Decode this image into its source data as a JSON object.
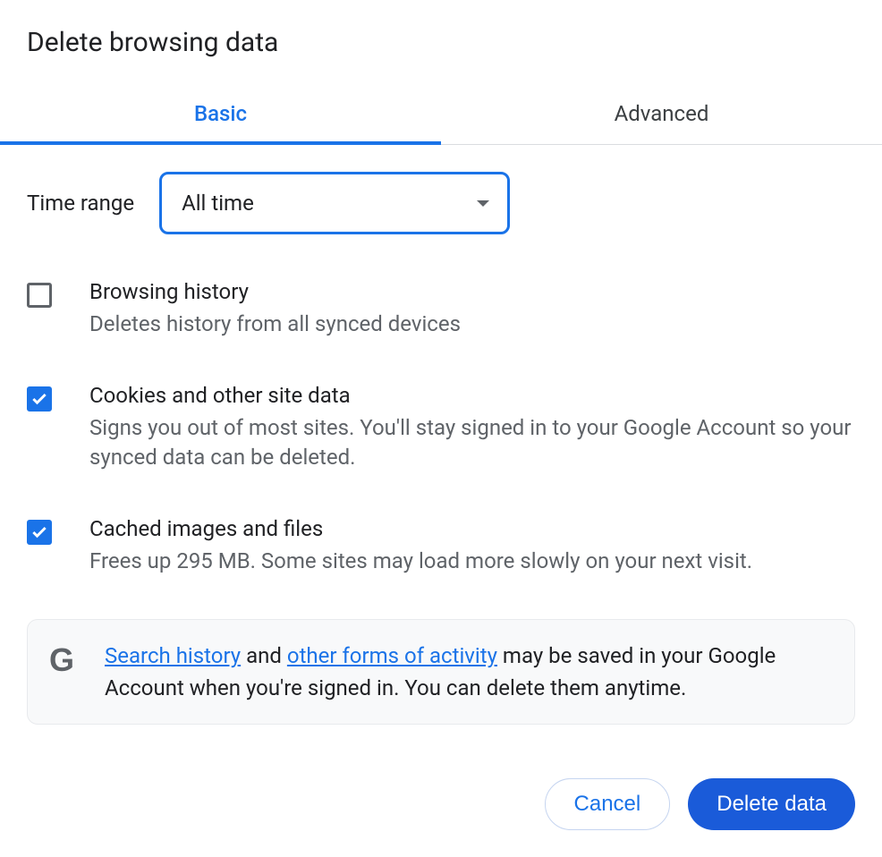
{
  "title": "Delete browsing data",
  "tabs": {
    "basic": "Basic",
    "advanced": "Advanced"
  },
  "time_range": {
    "label": "Time range",
    "value": "All time"
  },
  "options": [
    {
      "title": "Browsing history",
      "desc": "Deletes history from all synced devices",
      "checked": false
    },
    {
      "title": "Cookies and other site data",
      "desc": "Signs you out of most sites. You'll stay signed in to your Google Account so your synced data can be deleted.",
      "checked": true
    },
    {
      "title": "Cached images and files",
      "desc": "Frees up 295 MB. Some sites may load more slowly on your next visit.",
      "checked": true
    }
  ],
  "info": {
    "link1": "Search history",
    "mid1": " and ",
    "link2": "other forms of activity",
    "rest": " may be saved in your Google Account when you're signed in. You can delete them anytime."
  },
  "buttons": {
    "cancel": "Cancel",
    "delete": "Delete data"
  }
}
